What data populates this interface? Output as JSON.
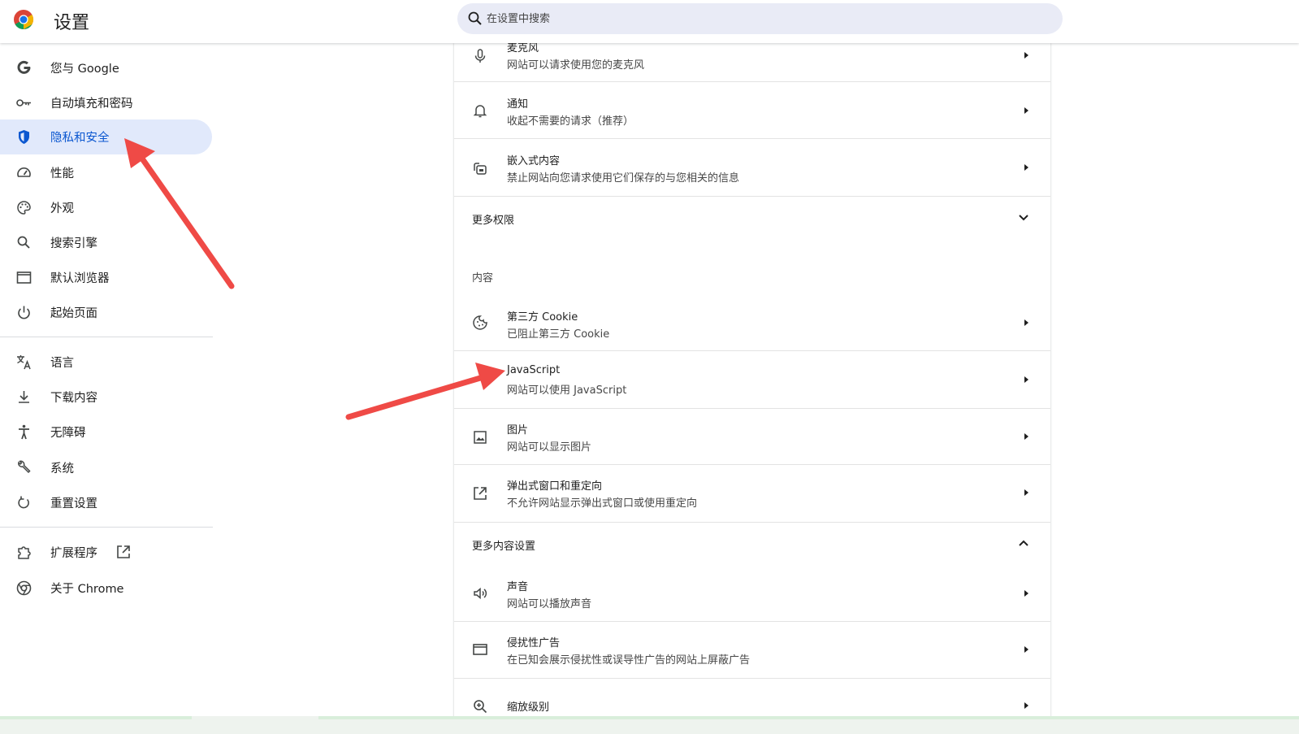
{
  "header": {
    "title": "设置",
    "search_placeholder": "在设置中搜索"
  },
  "sidebar": {
    "items": [
      {
        "label": "您与 Google",
        "icon": "google-g-icon"
      },
      {
        "label": "自动填充和密码",
        "icon": "key-icon"
      },
      {
        "label": "隐私和安全",
        "icon": "shield-icon",
        "active": true
      },
      {
        "label": "性能",
        "icon": "speedometer-icon"
      },
      {
        "label": "外观",
        "icon": "palette-icon"
      },
      {
        "label": "搜索引擎",
        "icon": "search-icon"
      },
      {
        "label": "默认浏览器",
        "icon": "browser-window-icon"
      },
      {
        "label": "起始页面",
        "icon": "power-icon"
      },
      {
        "label": "语言",
        "icon": "translate-icon"
      },
      {
        "label": "下载内容",
        "icon": "download-icon"
      },
      {
        "label": "无障碍",
        "icon": "accessibility-icon"
      },
      {
        "label": "系统",
        "icon": "wrench-icon"
      },
      {
        "label": "重置设置",
        "icon": "reset-icon"
      },
      {
        "label": "扩展程序",
        "icon": "puzzle-icon"
      },
      {
        "label": "关于 Chrome",
        "icon": "chrome-icon"
      }
    ]
  },
  "main": {
    "rows": [
      {
        "title": "麦克风",
        "subtitle": "网站可以请求使用您的麦克风",
        "icon": "microphone-icon"
      },
      {
        "title": "通知",
        "subtitle": "收起不需要的请求（推荐）",
        "icon": "bell-icon"
      },
      {
        "title": "嵌入式内容",
        "subtitle": "禁止网站向您请求使用它们保存的与您相关的信息",
        "icon": "embedded-content-icon"
      },
      {
        "title": "第三方 Cookie",
        "subtitle": "已阻止第三方 Cookie",
        "icon": "cookie-icon"
      },
      {
        "title": "JavaScript",
        "subtitle": "网站可以使用 JavaScript",
        "icon": "code-icon"
      },
      {
        "title": "图片",
        "subtitle": "网站可以显示图片",
        "icon": "image-icon"
      },
      {
        "title": "弹出式窗口和重定向",
        "subtitle": "不允许网站显示弹出式窗口或使用重定向",
        "icon": "open-in-new-icon"
      },
      {
        "title": "声音",
        "subtitle": "网站可以播放声音",
        "icon": "volume-icon"
      },
      {
        "title": "侵扰性广告",
        "subtitle": "在已知会展示侵扰性或误导性广告的网站上屏蔽广告",
        "icon": "ads-window-icon"
      },
      {
        "title": "缩放级别",
        "subtitle": "",
        "icon": "zoom-icon"
      }
    ],
    "more_permissions": "更多权限",
    "content_section": "内容",
    "more_content_settings": "更多内容设置"
  },
  "colors": {
    "accent": "#0b57d0",
    "active_bg": "#e1e9fb",
    "search_bg": "#e9ebf6",
    "annotation_red": "#ef4a46"
  }
}
